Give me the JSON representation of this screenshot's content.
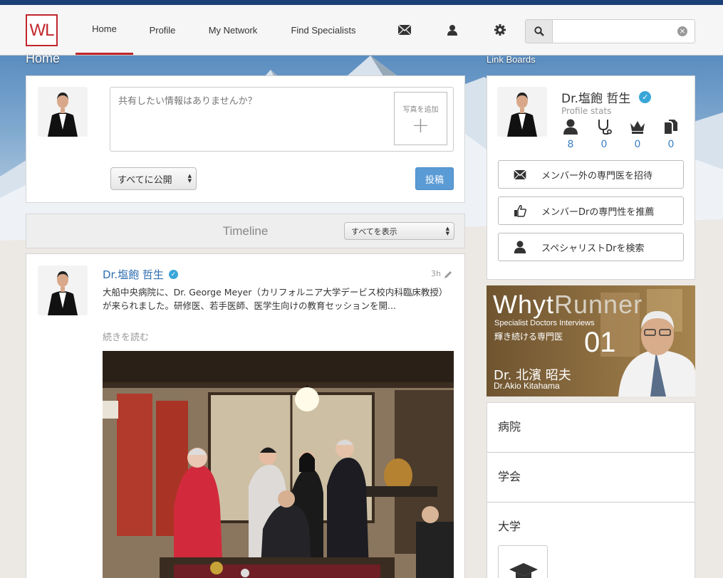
{
  "nav": {
    "logo": "WL",
    "items": [
      "Home",
      "Profile",
      "My Network",
      "Find Specialists"
    ],
    "icons": [
      "envelope-icon",
      "person-icon",
      "gear-icon"
    ],
    "search_placeholder": "",
    "accent": "#c1272d",
    "topbar": "#1d3f78"
  },
  "home": {
    "title": "Home",
    "compose_placeholder": "共有したい情報はありませんか？",
    "photo_add_label": "写真を追加",
    "photo_add_plus": "+",
    "visibility": "すべてに公開",
    "post_button": "投稿"
  },
  "timeline": {
    "title": "Timeline",
    "filter": "すべてを表示"
  },
  "post": {
    "author": "Dr.塩飽 哲生",
    "time": "3h",
    "text": "大船中央病院に、Dr. George Meyer（カリフォルニア大学デービス校内科臨床教授）が来られました。研修医、若手医師、医学生向けの教育セッションを開...",
    "read_more": "続きを読む"
  },
  "linkboards": {
    "title": "Link Boards",
    "name": "Dr.塩飽 哲生",
    "profile_stats": "Profile stats",
    "stats": [
      {
        "icon": "person-icon",
        "value": "8"
      },
      {
        "icon": "stethoscope-icon",
        "value": "0"
      },
      {
        "icon": "crown-icon",
        "value": "0"
      },
      {
        "icon": "documents-icon",
        "value": "0"
      }
    ],
    "buttons": [
      {
        "icon": "envelope-icon",
        "label": "メンバー外の専門医を招待"
      },
      {
        "icon": "thumbs-up-icon",
        "label": "メンバーDrの専門性を推薦"
      },
      {
        "icon": "person-icon",
        "label": "スペシャリストDrを検索"
      }
    ]
  },
  "banner": {
    "brand_a": "Whyt",
    "brand_b": "Runner",
    "subtitle": "Specialist Doctors Interviews",
    "tagline": "輝き続ける専門医",
    "number": "01",
    "doctor_jp": "Dr. 北濱 昭夫",
    "doctor_en": "Dr.Akio Kitahama"
  },
  "categories": [
    "病院",
    "学会",
    "大学"
  ]
}
